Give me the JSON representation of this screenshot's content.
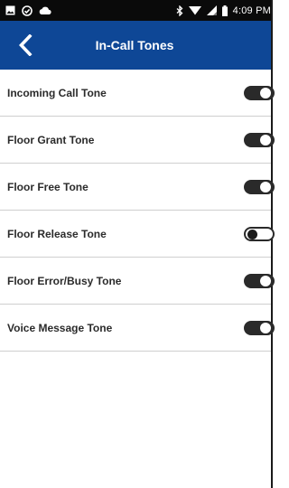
{
  "status_bar": {
    "left_icons": [
      "image-icon",
      "check-circle-icon",
      "cloud-icon"
    ],
    "right_icons": [
      "bluetooth-icon",
      "wifi-icon",
      "signal-icon",
      "battery-icon"
    ],
    "time": "4:09 PM"
  },
  "app_bar": {
    "title": "In-Call Tones",
    "back_icon": "chevron-left-icon",
    "background": "#0e4796"
  },
  "tones": [
    {
      "label": "Incoming Call Tone",
      "enabled": true
    },
    {
      "label": "Floor Grant Tone",
      "enabled": true
    },
    {
      "label": "Floor Free Tone",
      "enabled": true
    },
    {
      "label": "Floor Release Tone",
      "enabled": false
    },
    {
      "label": "Floor Error/Busy Tone",
      "enabled": true
    },
    {
      "label": "Voice Message Tone",
      "enabled": true
    }
  ]
}
